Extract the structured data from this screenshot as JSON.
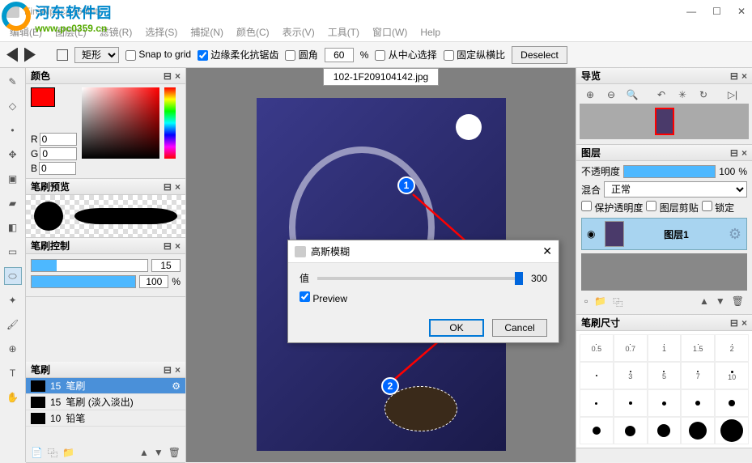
{
  "app": {
    "title": "FireAlpaca (64bit)"
  },
  "watermark": {
    "cn": "河东软件园",
    "url": "www.pc0359.cn"
  },
  "window_controls": {
    "min": "—",
    "max": "☐",
    "close": "✕"
  },
  "menu": {
    "items": [
      "编辑(E)",
      "图层(L)",
      "滤镜(R)",
      "选择(S)",
      "捕捉(N)",
      "颜色(C)",
      "表示(V)",
      "工具(T)",
      "窗口(W)",
      "Help"
    ]
  },
  "options": {
    "shape": "矩形",
    "snap_label": "Snap to grid",
    "antialias_label": "边缘柔化抗锯齿",
    "round_label": "圆角",
    "round_value": "60",
    "percent": "%",
    "from_center": "从中心选择",
    "fixed_ratio": "固定纵横比",
    "deselect": "Deselect"
  },
  "panels": {
    "color": {
      "title": "颜色",
      "r": "0",
      "g": "0",
      "b": "0",
      "r_label": "R",
      "g_label": "G",
      "b_label": "B"
    },
    "brush_preview": {
      "title": "笔刷预览"
    },
    "brush_control": {
      "title": "笔刷控制",
      "size": "15",
      "opacity": "100",
      "percent": "%"
    },
    "brushes": {
      "title": "笔刷",
      "items": [
        {
          "size": "15",
          "name": "笔刷"
        },
        {
          "size": "15",
          "name": "笔刷 (淡入淡出)"
        },
        {
          "size": "10",
          "name": "铅笔"
        }
      ]
    },
    "navigator": {
      "title": "导览"
    },
    "layers": {
      "title": "图层",
      "opacity_label": "不透明度",
      "opacity_value": "100",
      "percent": "%",
      "blend_label": "混合",
      "blend_value": "正常",
      "protect_alpha": "保护透明度",
      "clipping": "图层剪贴",
      "lock": "锁定",
      "layer1": "图层1"
    },
    "brush_size": {
      "title": "笔刷尺寸",
      "labels": [
        "0.5",
        "0.7",
        "1",
        "1.5",
        "2",
        "",
        "3",
        "5",
        "7",
        "10",
        "",
        "",
        "",
        "",
        ""
      ]
    }
  },
  "canvas": {
    "filename": "102-1F209104142.jpg"
  },
  "dialog": {
    "title": "高斯模糊",
    "value_label": "值",
    "value": "300",
    "preview": "Preview",
    "ok": "OK",
    "cancel": "Cancel"
  },
  "markers": {
    "m1": "1",
    "m2": "2"
  },
  "icons": {
    "dock": "⊟",
    "close_small": "×",
    "gear": "⚙",
    "eye": "👁",
    "zoom_in": "🔍+",
    "zoom_out": "🔍-",
    "zoom": "🔍",
    "rotate_l": "↶",
    "rotate_r": "↻",
    "loading": "✳",
    "flip": "▷|",
    "new": "📄",
    "copy": "📋",
    "folder": "📁",
    "delete": "🗑",
    "up": "▲",
    "down": "▼",
    "add": "📄",
    "dup": "⿻"
  }
}
